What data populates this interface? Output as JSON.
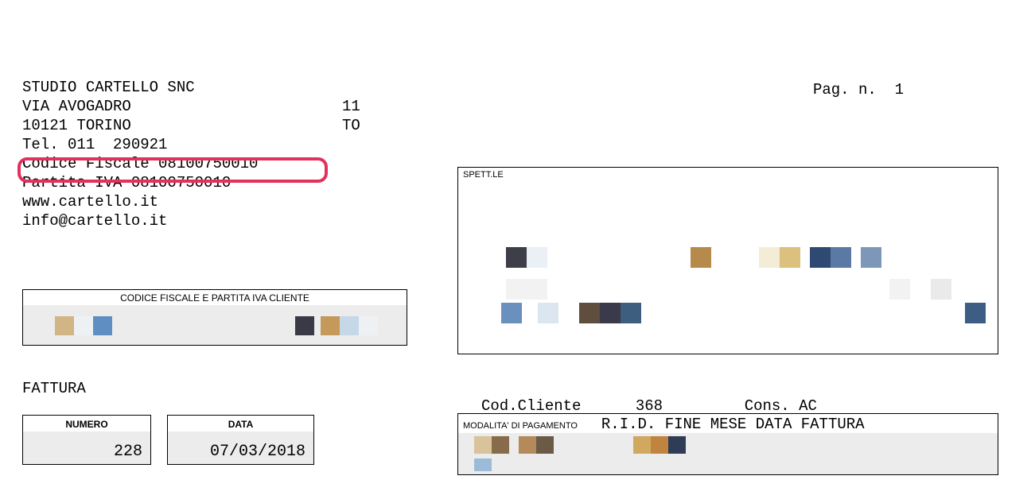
{
  "page": {
    "label": "Pag. n.",
    "number": "1"
  },
  "sender": {
    "name": "STUDIO CARTELLO SNC",
    "street": "VIA AVOGADRO",
    "street_no": "11",
    "zip_city": "10121 TORINO",
    "province": "TO",
    "tel": "Tel. 011  290921",
    "codfisc": "Codice Fiscale 08100750010",
    "piva": "Partita IVA 08100750010",
    "web": "www.cartello.it",
    "email": "info@cartello.it"
  },
  "client_codfisc": {
    "label": "CODICE FISCALE E PARTITA IVA CLIENTE"
  },
  "spettle": {
    "label": "SPETT.LE"
  },
  "fattura_title": "FATTURA",
  "codcliente": {
    "label": "Cod.Cliente",
    "value": "368"
  },
  "cons": {
    "label": "Cons.",
    "value": "AC"
  },
  "numero": {
    "label": "NUMERO",
    "value": "228"
  },
  "data": {
    "label": "DATA",
    "value": "07/03/2018"
  },
  "pagamento": {
    "label": "MODALITA' DI PAGAMENTO",
    "value": "R.I.D. FINE MESE DATA FATTURA"
  }
}
